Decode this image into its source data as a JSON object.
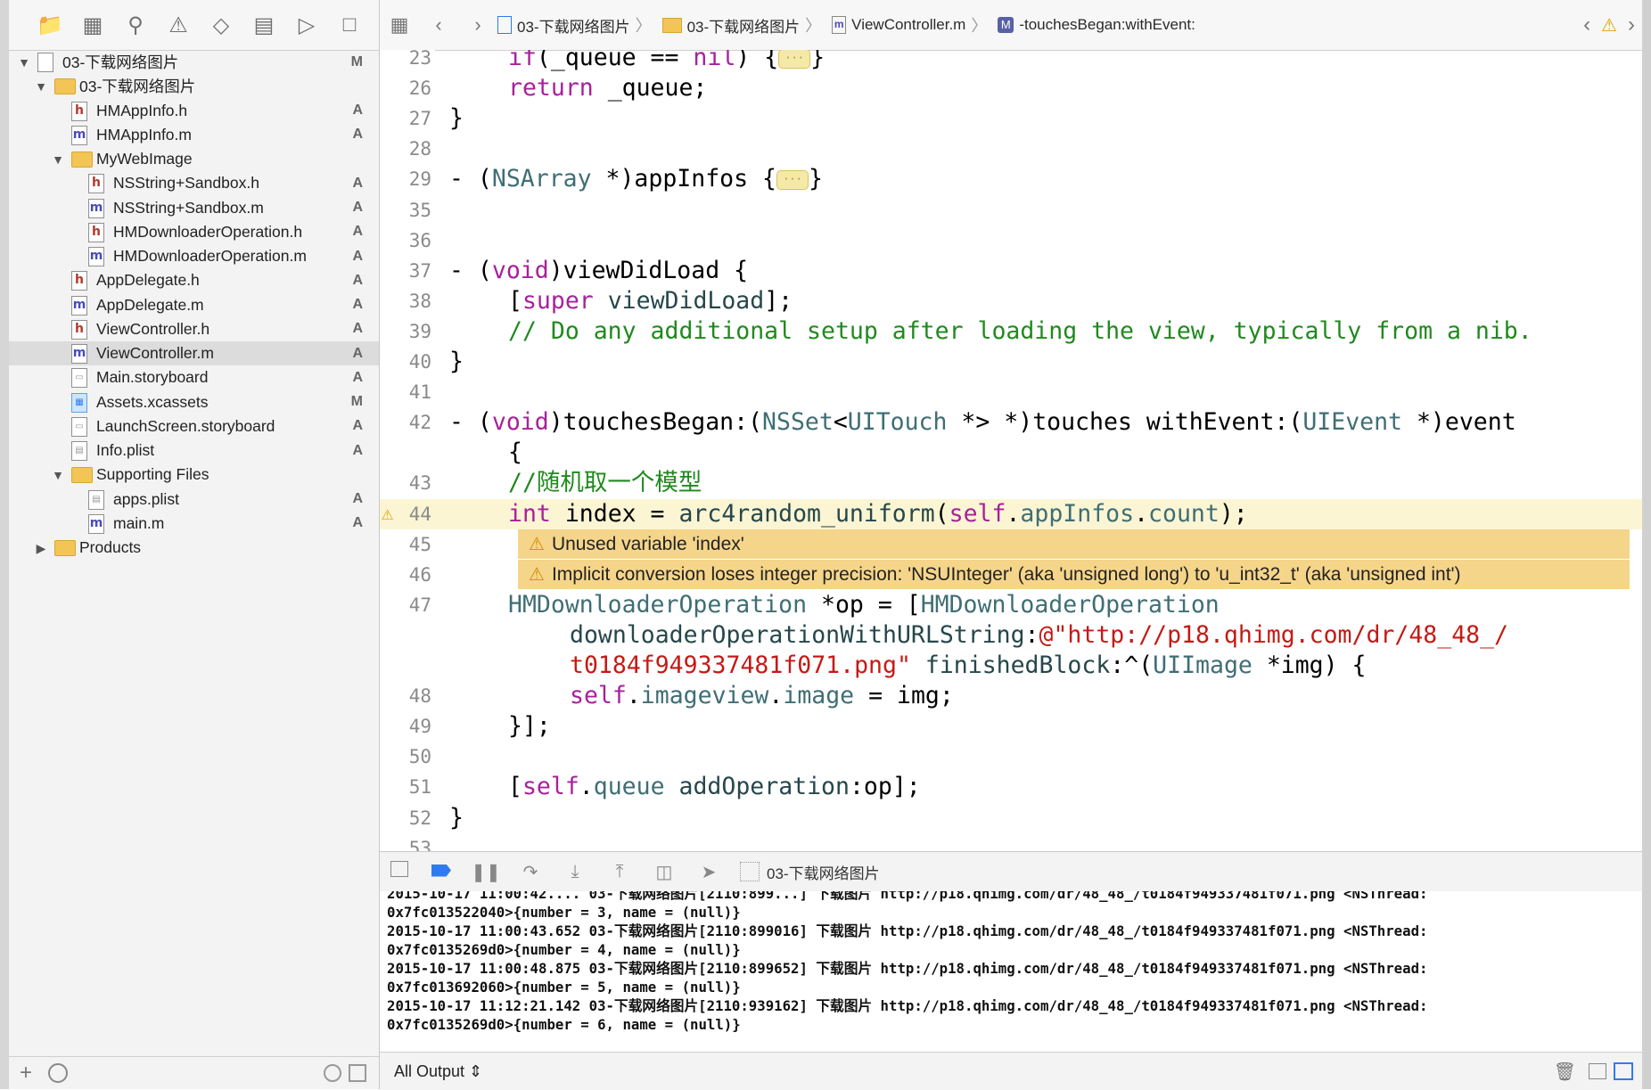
{
  "navigator": {
    "items": [
      {
        "label": "03-下载网络图片",
        "status": "M",
        "kind": "project",
        "depth": 0,
        "disclosure": "open"
      },
      {
        "label": "03-下载网络图片",
        "status": "",
        "kind": "folder",
        "depth": 1,
        "disclosure": "open"
      },
      {
        "label": "HMAppInfo.h",
        "status": "A",
        "kind": "h",
        "depth": 2
      },
      {
        "label": "HMAppInfo.m",
        "status": "A",
        "kind": "m",
        "depth": 2
      },
      {
        "label": "MyWebImage",
        "status": "",
        "kind": "folder",
        "depth": 2,
        "disclosure": "open"
      },
      {
        "label": "NSString+Sandbox.h",
        "status": "A",
        "kind": "h",
        "depth": 3
      },
      {
        "label": "NSString+Sandbox.m",
        "status": "A",
        "kind": "m",
        "depth": 3
      },
      {
        "label": "HMDownloaderOperation.h",
        "status": "A",
        "kind": "h",
        "depth": 3
      },
      {
        "label": "HMDownloaderOperation.m",
        "status": "A",
        "kind": "m",
        "depth": 3
      },
      {
        "label": "AppDelegate.h",
        "status": "A",
        "kind": "h",
        "depth": 2
      },
      {
        "label": "AppDelegate.m",
        "status": "A",
        "kind": "m",
        "depth": 2
      },
      {
        "label": "ViewController.h",
        "status": "A",
        "kind": "h",
        "depth": 2
      },
      {
        "label": "ViewController.m",
        "status": "A",
        "kind": "m",
        "depth": 2,
        "selected": true
      },
      {
        "label": "Main.storyboard",
        "status": "A",
        "kind": "sb",
        "depth": 2
      },
      {
        "label": "Assets.xcassets",
        "status": "M",
        "kind": "assets",
        "depth": 2
      },
      {
        "label": "LaunchScreen.storyboard",
        "status": "A",
        "kind": "sb",
        "depth": 2
      },
      {
        "label": "Info.plist",
        "status": "A",
        "kind": "plist",
        "depth": 2
      },
      {
        "label": "Supporting Files",
        "status": "",
        "kind": "folder",
        "depth": 2,
        "disclosure": "open"
      },
      {
        "label": "apps.plist",
        "status": "A",
        "kind": "plist",
        "depth": 3
      },
      {
        "label": "main.m",
        "status": "A",
        "kind": "m",
        "depth": 3
      },
      {
        "label": "Products",
        "status": "",
        "kind": "folder",
        "depth": 1,
        "disclosure": "closed"
      }
    ]
  },
  "jumpbar": {
    "crumbs": [
      "03-下载网络图片",
      "03-下载网络图片",
      "ViewController.m",
      "-touchesBegan:withEvent:"
    ],
    "method_badge": "M",
    "file_badge": "m"
  },
  "editor": {
    "lines": [
      {
        "n": "23",
        "html": "<span class='kw'>if</span>(_queue == <span class='kw'>nil</span>) {<span class='fold'>···</span>}",
        "indent": 1
      },
      {
        "n": "26",
        "html": "<span class='kw'>return</span> _queue;",
        "indent": 1
      },
      {
        "n": "27",
        "html": "}",
        "indent": 0
      },
      {
        "n": "28",
        "html": "",
        "indent": 0
      },
      {
        "n": "29",
        "html": "- (<span class='cls'>NSArray</span> *)appInfos {<span class='fold'>···</span>}",
        "indent": 0
      },
      {
        "n": "35",
        "html": "",
        "indent": 0
      },
      {
        "n": "36",
        "html": "",
        "indent": 0
      },
      {
        "n": "37",
        "html": "- (<span class='kw'>void</span>)viewDidLoad {",
        "indent": 0
      },
      {
        "n": "38",
        "html": "[<span class='kw'>super</span> <span class='meth'>viewDidLoad</span>];",
        "indent": 1
      },
      {
        "n": "39",
        "html": "<span class='cmt'>// Do any additional setup after loading the view, typically from a nib.</span>",
        "indent": 1
      },
      {
        "n": "40",
        "html": "}",
        "indent": 0
      },
      {
        "n": "41",
        "html": "",
        "indent": 0
      },
      {
        "n": "42",
        "html": "- (<span class='kw'>void</span>)touchesBegan:(<span class='cls'>NSSet</span>&lt;<span class='cls'>UITouch</span> *&gt; *)touches withEvent:(<span class='cls'>UIEvent</span> *)event",
        "indent": 0
      },
      {
        "n": "",
        "html": "{",
        "indent": 1
      },
      {
        "n": "43",
        "html": "<span class='cmt'>//随机取一个模型</span>",
        "indent": 1
      },
      {
        "n": "44",
        "html": "<span class='kw'>int</span> index = <span class='meth'>arc4random_uniform</span>(<span class='kw'>self</span>.<span class='prop'>appInfos</span>.<span class='prop'>count</span>);",
        "indent": 1,
        "warn": true
      },
      {
        "n": "45",
        "warnmsg": "Unused variable 'index'",
        "indent": 0
      },
      {
        "n": "46",
        "warnmsg": "Implicit conversion loses integer precision: 'NSUInteger' (aka 'unsigned long') to 'u_int32_t' (aka 'unsigned int')",
        "indent": 0
      },
      {
        "n": "47",
        "html": "<span class='cls'>HMDownloaderOperation</span> *op = [<span class='cls'>HMDownloaderOperation</span>",
        "indent": 1
      },
      {
        "n": "",
        "html": "<span class='meth'>downloaderOperationWithURLString</span>:<span class='str'>@\"http://p18.qhimg.com/dr/48_48_/</span>",
        "indent": 2
      },
      {
        "n": "",
        "html": "<span class='str'>t0184f949337481f071.png\"</span> <span class='meth'>finishedBlock</span>:^(<span class='cls'>UIImage</span> *img) {",
        "indent": 2
      },
      {
        "n": "48",
        "html": "<span class='kw'>self</span>.<span class='prop'>imageview</span>.<span class='prop'>image</span> = img;",
        "indent": 2
      },
      {
        "n": "49",
        "html": "}];",
        "indent": 1
      },
      {
        "n": "50",
        "html": "",
        "indent": 0
      },
      {
        "n": "51",
        "html": "[<span class='kw'>self</span>.<span class='prop'>queue</span> <span class='meth'>addOperation</span>:op];",
        "indent": 1
      },
      {
        "n": "52",
        "html": "}",
        "indent": 0
      },
      {
        "n": "53",
        "html": "",
        "indent": 0
      }
    ]
  },
  "debug": {
    "target_label": "03-下载网络图片",
    "output_filter": "All Output ⇕",
    "console_lines": [
      "2015-10-17 11:00:42.... 03-下载网络图片[2110:899...] 下载图片 http://p18.qhimg.com/dr/48_48_/t0184f949337481f071.png <NSThread:",
      "0x7fc013522040>{number = 3, name = (null)}",
      "2015-10-17 11:00:43.652 03-下载网络图片[2110:899016] 下载图片 http://p18.qhimg.com/dr/48_48_/t0184f949337481f071.png <NSThread:",
      "0x7fc0135269d0>{number = 4, name = (null)}",
      "2015-10-17 11:00:48.875 03-下载网络图片[2110:899652] 下载图片 http://p18.qhimg.com/dr/48_48_/t0184f949337481f071.png <NSThread:",
      "0x7fc013692060>{number = 5, name = (null)}",
      "2015-10-17 11:12:21.142 03-下载网络图片[2110:939162] 下载图片 http://p18.qhimg.com/dr/48_48_/t0184f949337481f071.png <NSThread:",
      "0x7fc0135269d0>{number = 6, name = (null)}"
    ]
  },
  "colors": {
    "accent": "#2d7cf0",
    "warning_band": "#f5d58a",
    "highlight_line": "#fbf5d3",
    "selection": "#dcdcdc"
  }
}
